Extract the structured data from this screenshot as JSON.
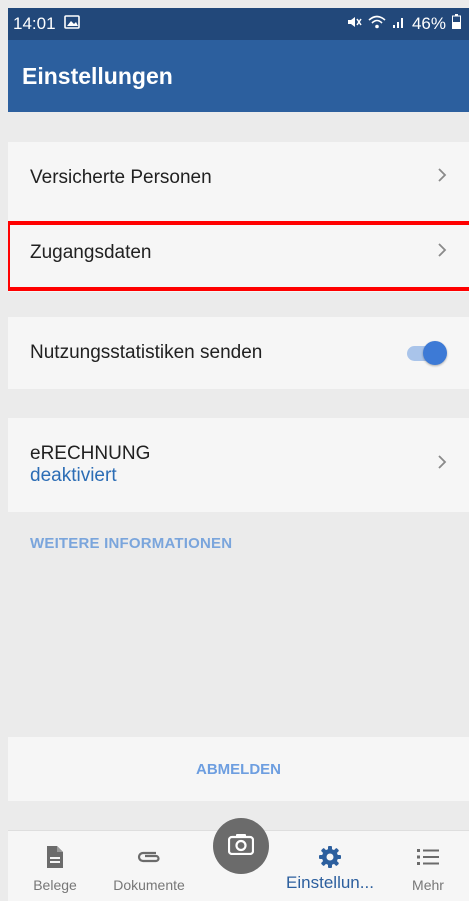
{
  "status_bar": {
    "time": "14:01",
    "battery": "46%"
  },
  "header": {
    "title": "Einstellungen"
  },
  "rows": {
    "insured": {
      "label": "Versicherte Personen"
    },
    "access": {
      "label": "Zugangsdaten"
    },
    "stats": {
      "label": "Nutzungsstatistiken senden",
      "toggle_on": true
    },
    "erechnung": {
      "label": "eRECHNUNG",
      "status": "deaktiviert"
    }
  },
  "links": {
    "more_info": "WEITERE INFORMATIONEN"
  },
  "logout": {
    "label": "ABMELDEN"
  },
  "bottom_nav": {
    "belege": "Belege",
    "dokumente": "Dokumente",
    "einstellungen": "Einstellun...",
    "mehr": "Mehr"
  },
  "colors": {
    "app_bar": "#2c5f9e",
    "status_bar": "#22487a",
    "accent": "#3d7ad6",
    "highlight": "#ff0000"
  }
}
